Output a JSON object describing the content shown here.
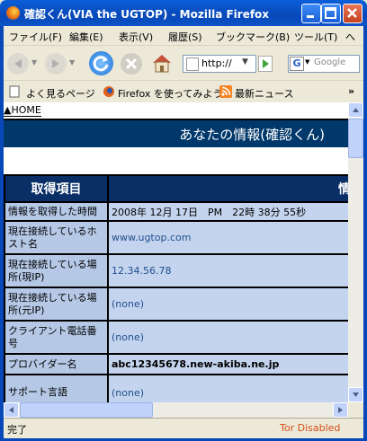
{
  "window": {
    "title": "確認くん(VIA the UGTOP) - Mozilla Firefox"
  },
  "menu": [
    "ファイル(F)",
    "編集(E)",
    "表示(V)",
    "履歴(S)",
    "ブックマーク(B)",
    "ツール(T)",
    "へ"
  ],
  "toolbar": {
    "url": "http://",
    "search_placeholder": "Google"
  },
  "bookmarks": [
    "よく見るページ",
    "Firefox を使ってみよう",
    "最新ニュース"
  ],
  "page": {
    "home_link": "▲HOME",
    "header_title": "あなたの情報(確認くん)",
    "col_item": "取得項目",
    "col_info": "情",
    "rows": [
      {
        "label": "情報を取得した時間",
        "value": "2008年 12月 17日　PM　22時 38分 55秒"
      },
      {
        "label": "現在接続しているホスト名",
        "value": "www.ugtop.com"
      },
      {
        "label": "現在接続している場所(現IP)",
        "value": "12.34.56.78"
      },
      {
        "label": "現在接続している場所(元IP)",
        "value": "(none)"
      },
      {
        "label": "クライアント電話番号",
        "value": "(none)"
      },
      {
        "label": "プロバイダー名",
        "value": "abc12345678.new-akiba.ne.jp"
      },
      {
        "label": "サポート言語",
        "value": "(none)"
      }
    ]
  },
  "status": {
    "text": "完了",
    "tor": "Tor Disabled"
  },
  "colors": {
    "title_bar": "#0848b8",
    "page_header": "#00386b",
    "key_cell": "#b5c8e6",
    "value_cell": "#c4d4ee",
    "tor_status": "#d64e16"
  }
}
